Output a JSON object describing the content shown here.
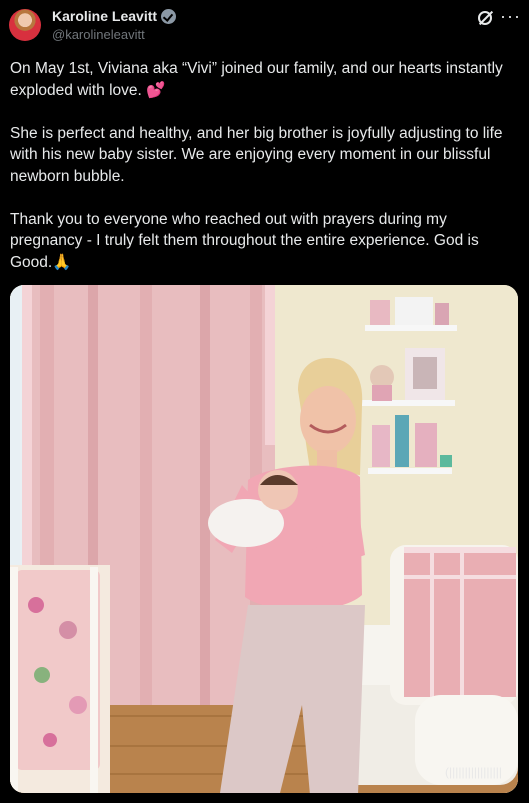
{
  "author": {
    "display_name": "Karoline Leavitt",
    "handle": "@karolineleavitt",
    "verified_icon": "verified-badge-icon"
  },
  "actions": {
    "grok_icon": "grok-icon",
    "more_icon": "more-horizontal-icon"
  },
  "post": {
    "paragraphs": [
      "On May 1st, Viviana aka “Vivi” joined our family, and our hearts instantly exploded with love. 💕",
      "She is perfect and healthy, and her big brother is joyfully adjusting to life with his new baby sister. We are enjoying every moment in our blissful newborn bubble.",
      "Thank you to everyone who reached out with prayers during my pregnancy - I truly felt them throughout the entire experience. God is Good.🙏"
    ]
  },
  "photo": {
    "watermark": "(|||||||||||||||||"
  },
  "colors": {
    "background": "#000000",
    "text": "#e7e9ea",
    "muted": "#71767b"
  }
}
